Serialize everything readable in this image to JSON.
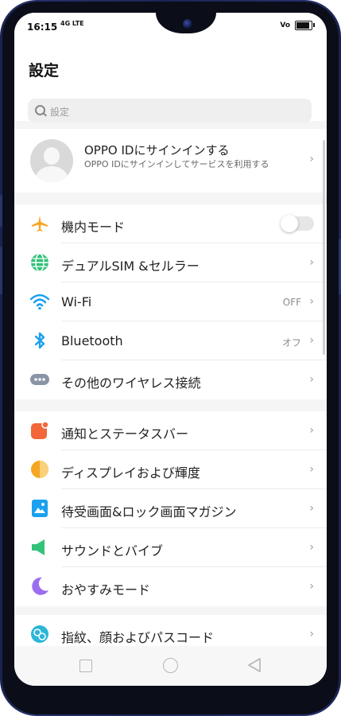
{
  "status_bar": {
    "time": "16:15",
    "signal_text": "4G LTE",
    "volte": "Vo",
    "battery_level": 0.78
  },
  "header": {
    "title": "設定"
  },
  "search": {
    "placeholder": "設定"
  },
  "account": {
    "title": "OPPO IDにサインインする",
    "subtitle": "OPPO IDにサインインしてサービスを利用する"
  },
  "connectivity": [
    {
      "icon": "airplane-icon",
      "label": "機内モード",
      "control": "toggle",
      "on": false
    },
    {
      "icon": "globe-icon",
      "label": "デュアルSIM &セルラー",
      "value": ""
    },
    {
      "icon": "wifi-icon",
      "label": "Wi-Fi",
      "value": "OFF"
    },
    {
      "icon": "bluetooth-icon",
      "label": "Bluetooth",
      "value": "オフ"
    },
    {
      "icon": "more-icon",
      "label": "その他のワイヤレス接続",
      "value": ""
    }
  ],
  "display": [
    {
      "icon": "notification-icon",
      "label": "通知とステータスバー"
    },
    {
      "icon": "brightness-icon",
      "label": "ディスプレイおよび輝度"
    },
    {
      "icon": "wallpaper-icon",
      "label": "待受画面&ロック画面マガジン"
    },
    {
      "icon": "sound-icon",
      "label": "サウンドとバイブ"
    },
    {
      "icon": "moon-icon",
      "label": "おやすみモード"
    }
  ],
  "security": [
    {
      "icon": "fingerprint-face-icon",
      "label": "指紋、顔およびパスコード"
    }
  ],
  "chevron": "›",
  "colors": {
    "airplane": "#f5a623",
    "globe": "#33c27a",
    "wifi": "#1aa0f0",
    "bluetooth": "#1aa0f0",
    "more": "#8a94a6",
    "notification": "#f2673a",
    "brightness": "#f5a623",
    "wallpaper": "#1aa0f0",
    "sound": "#33c27a",
    "moon": "#9b6ef0",
    "security": "#2bb6d8"
  }
}
